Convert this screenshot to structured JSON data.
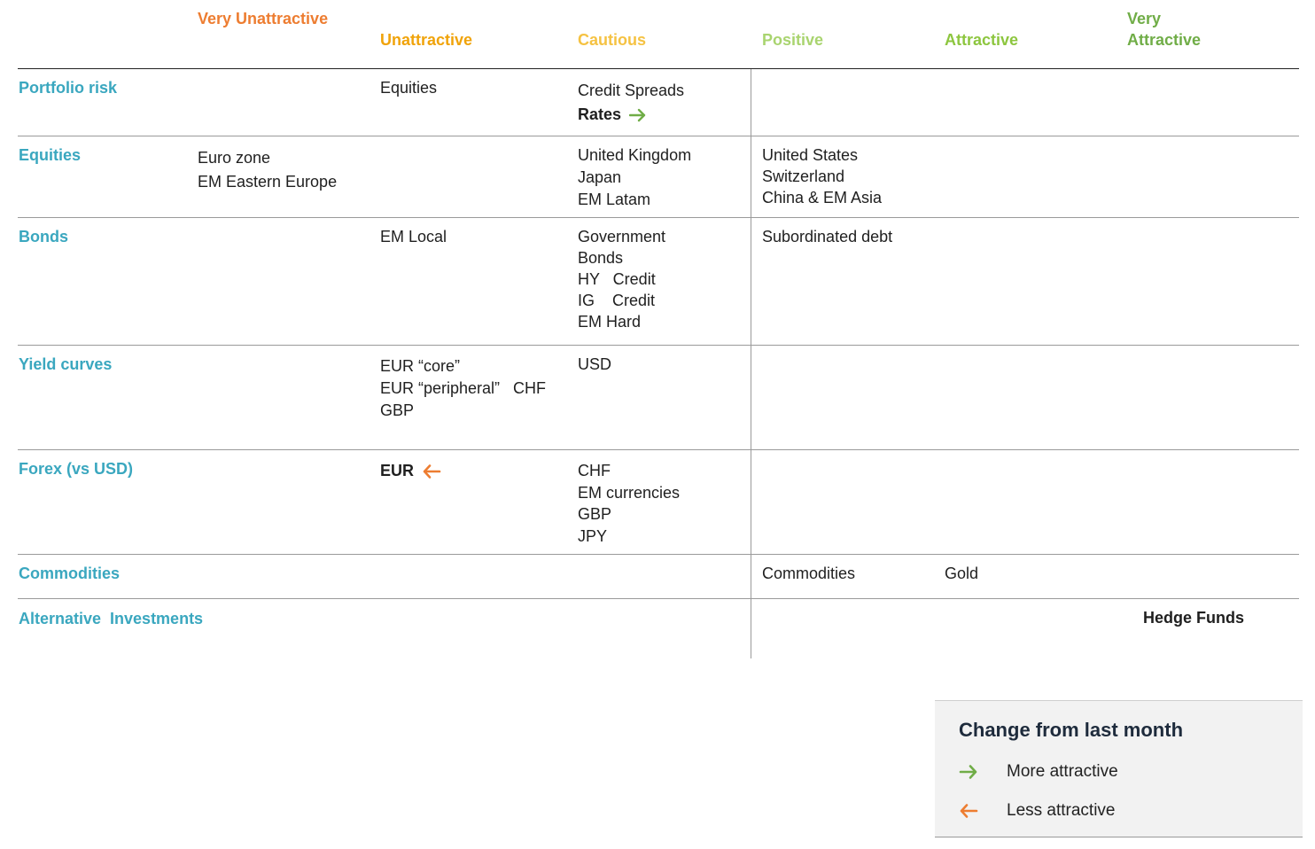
{
  "header": {
    "very_unattractive": "Very  Unattractive",
    "unattractive": "Unattractive",
    "cautious": "Cautious",
    "positive": "Positive",
    "attractive": "Attractive",
    "very_attractive_1": "Very",
    "very_attractive_2": "Attractive",
    "colors": {
      "very_unattractive": "#ed7d31",
      "unattractive": "#f0a30a",
      "cautious": "#f5c242",
      "positive": "#a9d46f",
      "attractive": "#8dc63f",
      "very_attractive": "#70ad47"
    }
  },
  "rows": {
    "portfolio_risk": {
      "label": "Portfolio risk",
      "unattractive": [
        "Equities"
      ],
      "cautious": [
        "Credit Spreads"
      ],
      "cautious_bold": "Rates",
      "cautious_bold_change": "more-attractive"
    },
    "equities": {
      "label": "Equities",
      "very_unattractive": [
        "Euro zone",
        "EM Eastern Europe"
      ],
      "cautious": [
        "United Kingdom",
        "Japan",
        "EM Latam"
      ],
      "positive": [
        "United States",
        "Switzerland",
        "China & EM Asia"
      ]
    },
    "bonds": {
      "label": "Bonds",
      "unattractive": [
        "EM Local"
      ],
      "cautious": [
        "Government",
        "Bonds",
        "HY   Credit",
        "IG    Credit",
        "EM Hard"
      ],
      "positive": [
        "Subordinated debt"
      ]
    },
    "yield_curves": {
      "label": "Yield curves",
      "unattractive": [
        "EUR “core”",
        "EUR “peripheral”   CHF",
        "GBP"
      ],
      "cautious": [
        "USD"
      ]
    },
    "forex": {
      "label": "Forex (vs USD)",
      "unattractive_bold": "EUR",
      "unattractive_bold_change": "less-attractive",
      "cautious": [
        "CHF",
        "EM currencies",
        "GBP",
        "JPY"
      ]
    },
    "commodities": {
      "label": "Commodities",
      "positive": [
        "Commodities"
      ],
      "attractive": [
        "Gold"
      ]
    },
    "alternative": {
      "label": "Alternative  Investments",
      "very_attractive_bold": "Hedge Funds"
    }
  },
  "legend": {
    "title": "Change from last month",
    "more": "More attractive",
    "less": "Less attractive",
    "more_color": "#70ad47",
    "less_color": "#ed7d31",
    "more_icon": "arrow-right-icon",
    "less_icon": "arrow-left-icon"
  },
  "colors": {
    "category": "#3aa7bf",
    "text": "#1f1f1f",
    "rule": "#9a9a9a",
    "legend_bg": "#f2f2f2"
  }
}
